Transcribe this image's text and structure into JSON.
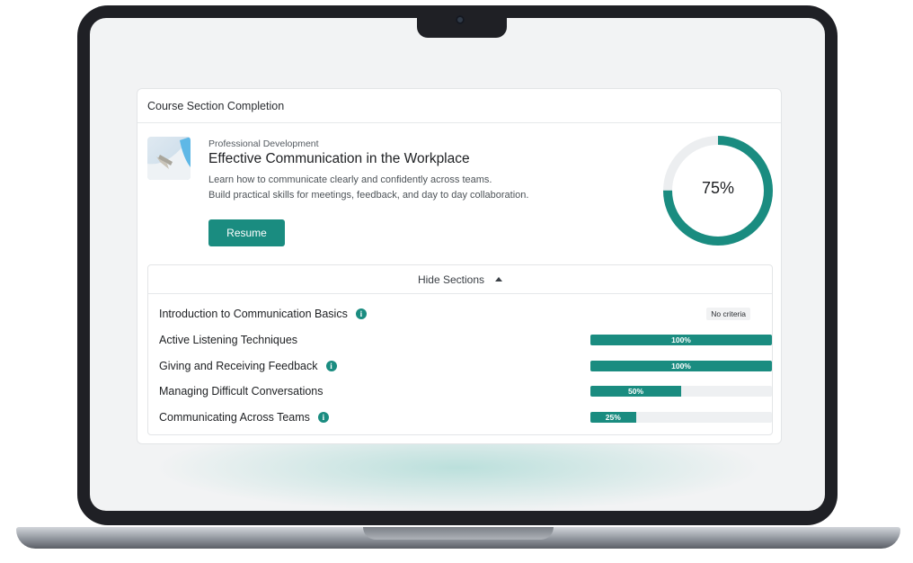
{
  "card": {
    "title": "Course Section Completion"
  },
  "course": {
    "category": "Professional Development",
    "title": "Effective Communication in the Workplace",
    "description_line1": "Learn how to communicate clearly and confidently across teams.",
    "description_line2": "Build practical skills for meetings, feedback, and day to day collaboration.",
    "resume_label": "Resume",
    "completion_percent": 75,
    "completion_label": "75%"
  },
  "sections": {
    "toggle_label": "Hide Sections",
    "items": [
      {
        "title": "Introduction to Communication Basics",
        "info": true,
        "progress": null,
        "progress_label": "",
        "badge": "No criteria"
      },
      {
        "title": "Active Listening Techniques",
        "info": false,
        "progress": 100,
        "progress_label": "100%",
        "badge": ""
      },
      {
        "title": "Giving and Receiving Feedback",
        "info": true,
        "progress": 100,
        "progress_label": "100%",
        "badge": ""
      },
      {
        "title": "Managing Difficult Conversations",
        "info": false,
        "progress": 50,
        "progress_label": "50%",
        "badge": ""
      },
      {
        "title": "Communicating Across Teams",
        "info": true,
        "progress": 25,
        "progress_label": "25%",
        "badge": ""
      }
    ]
  },
  "colors": {
    "accent": "#1a8c80",
    "track": "#eef0f2"
  },
  "icons": {
    "info": "info-icon",
    "caret": "caret-up-icon",
    "thumbnail": "course-thumbnail"
  }
}
